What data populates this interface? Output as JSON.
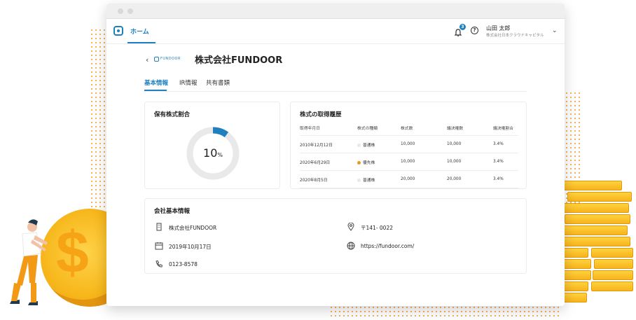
{
  "nav": {
    "home_label": "ホーム",
    "notification_count": "3",
    "help_glyph": "?",
    "user_name": "山田 太郎",
    "user_company": "株式会社日本クラウドキャピタル"
  },
  "header": {
    "back_glyph": "‹",
    "logo_text": "FUNDOOR",
    "company_name": "株式会社FUNDOOR"
  },
  "tabs": [
    "基本情報",
    "IR情報",
    "共有書類"
  ],
  "holding": {
    "title": "保有株式割合",
    "percent": 10,
    "value_text": "10",
    "unit": "%"
  },
  "history": {
    "title": "株式の取得履歴",
    "columns": [
      "取得年月日",
      "株式の種類",
      "株式数",
      "議決権数",
      "議決権割合"
    ],
    "rows": [
      {
        "date": "2010年12月12日",
        "type": "普通株",
        "type_color": "#e8e8e8",
        "shares": "10,000",
        "votes": "10,000",
        "ratio": "3.4%"
      },
      {
        "date": "2020年6月29日",
        "type": "優先株",
        "type_color": "#e89b1a",
        "shares": "10,000",
        "votes": "10,000",
        "ratio": "3.4%"
      },
      {
        "date": "2020年8月5日",
        "type": "普通株",
        "type_color": "#e8e8e8",
        "shares": "20,000",
        "votes": "20,000",
        "ratio": "3.4%"
      }
    ]
  },
  "company_info": {
    "title": "会社基本情報",
    "name": "株式会社FUNDOOR",
    "founded": "2019年10月17日",
    "phone": "0123-8578",
    "postal": "〒141- 0022",
    "url": "https://fundoor.com/"
  },
  "colors": {
    "accent": "#1f7fbf",
    "coin": "#f7b71c"
  }
}
